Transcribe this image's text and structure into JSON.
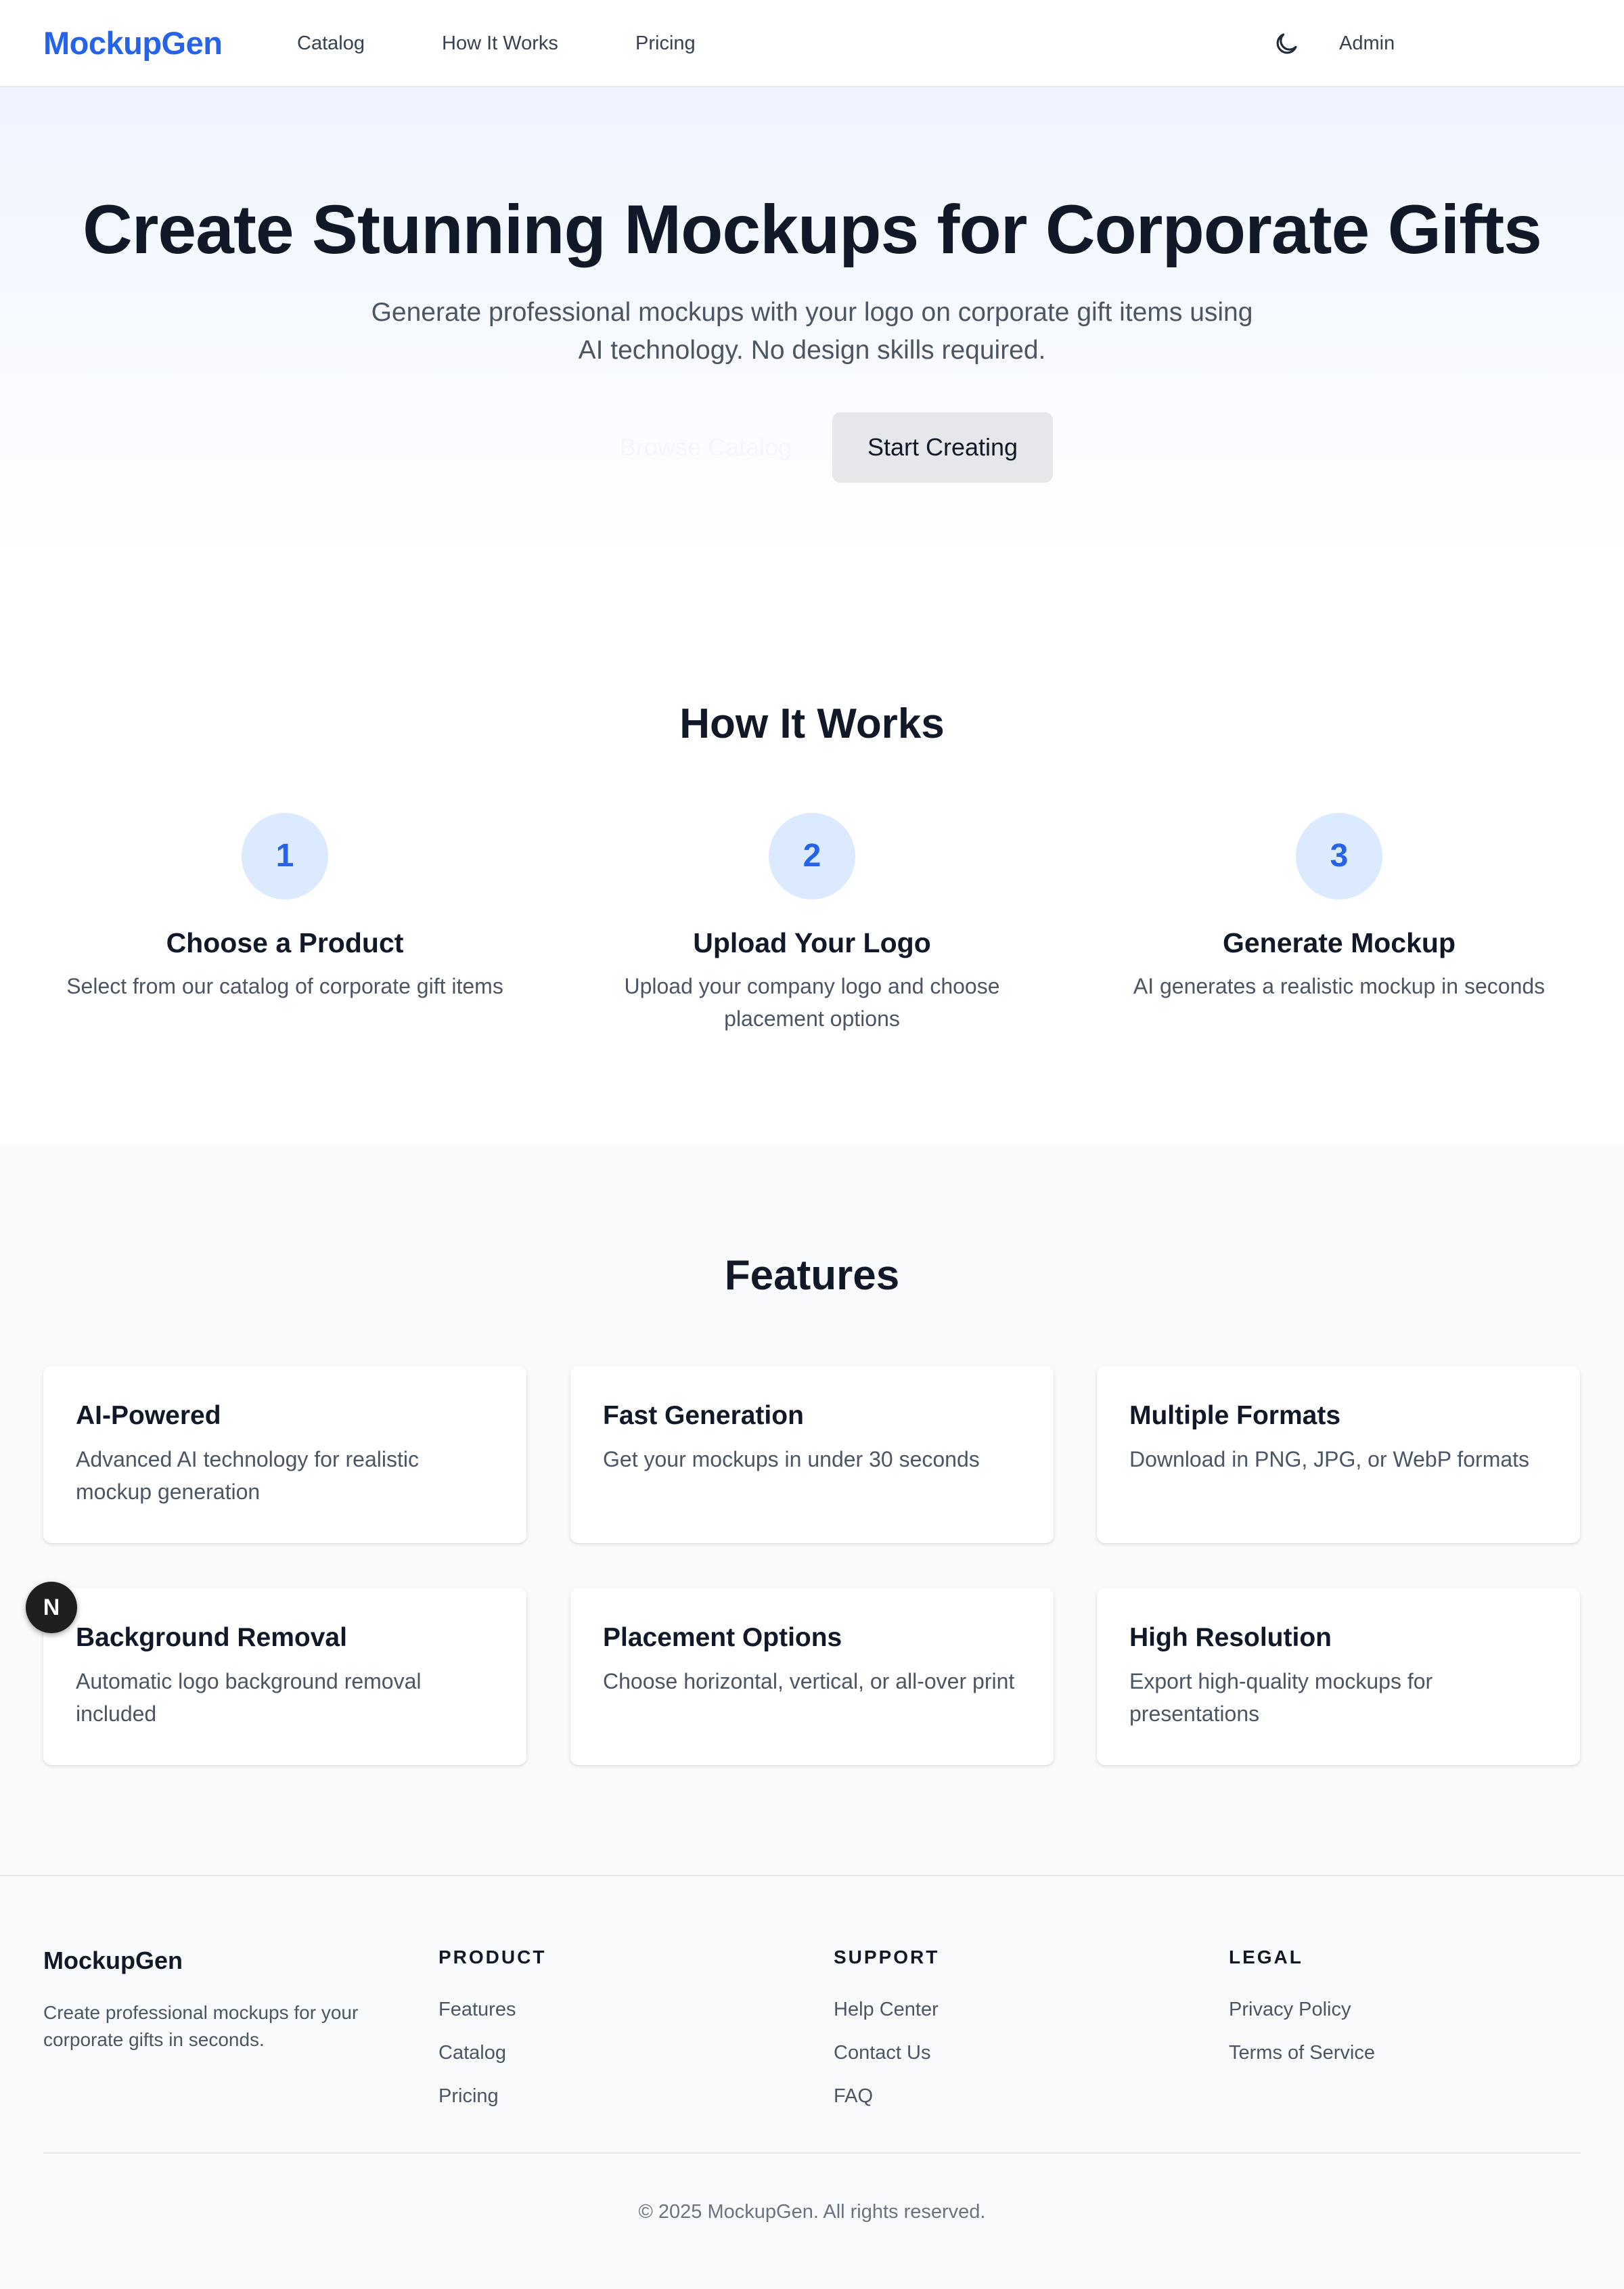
{
  "nav": {
    "logo": "MockupGen",
    "links": [
      "Catalog",
      "How It Works",
      "Pricing"
    ],
    "theme_icon": "moon-icon",
    "admin": "Admin"
  },
  "hero": {
    "title": "Create Stunning Mockups for Corporate Gifts",
    "subtitle_line1": "Generate professional mockups with your logo on corporate gift items using",
    "subtitle_line2": "AI technology. No design skills required.",
    "browse_button": "Browse Catalog",
    "start_button": "Start Creating"
  },
  "how": {
    "title": "How It Works",
    "steps": [
      {
        "number": "1",
        "title": "Choose a Product",
        "desc": "Select from our catalog of corporate gift items"
      },
      {
        "number": "2",
        "title": "Upload Your Logo",
        "desc": "Upload your company logo and choose placement options"
      },
      {
        "number": "3",
        "title": "Generate Mockup",
        "desc": "AI generates a realistic mockup in seconds"
      }
    ]
  },
  "features": {
    "title": "Features",
    "items": [
      {
        "title": "AI-Powered",
        "desc": "Advanced AI technology for realistic mockup generation"
      },
      {
        "title": "Fast Generation",
        "desc": "Get your mockups in under 30 seconds"
      },
      {
        "title": "Multiple Formats",
        "desc": "Download in PNG, JPG, or WebP formats"
      },
      {
        "title": "Background Removal",
        "desc": "Automatic logo background removal included"
      },
      {
        "title": "Placement Options",
        "desc": "Choose horizontal, vertical, or all-over print"
      },
      {
        "title": "High Resolution",
        "desc": "Export high-quality mockups for presentations"
      }
    ]
  },
  "dev_badge": "N",
  "footer": {
    "brand": "MockupGen",
    "tagline": "Create professional mockups for your corporate gifts in seconds.",
    "columns": [
      {
        "heading": "PRODUCT",
        "links": [
          "Features",
          "Catalog",
          "Pricing"
        ]
      },
      {
        "heading": "SUPPORT",
        "links": [
          "Help Center",
          "Contact Us",
          "FAQ"
        ]
      },
      {
        "heading": "LEGAL",
        "links": [
          "Privacy Policy",
          "Terms of Service"
        ]
      }
    ],
    "copyright": "© 2025 MockupGen. All rights reserved."
  },
  "colors": {
    "accent": "#2563eb",
    "step_circle": "#dbeafe",
    "hero_gradient_top": "#eef4ff",
    "features_bg": "#f9fafb"
  }
}
